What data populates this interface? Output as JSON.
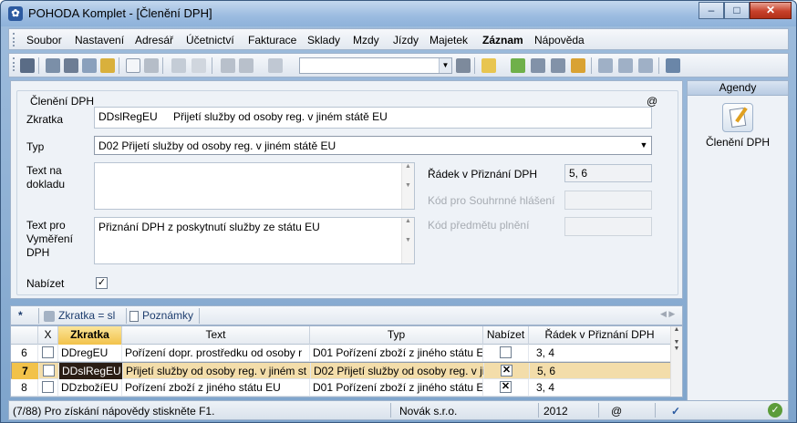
{
  "window": {
    "title": "POHODA Komplet - [Členění DPH]",
    "min": "–",
    "max": "□",
    "close": "✕"
  },
  "menu": [
    "Soubor",
    "Nastavení",
    "Adresář",
    "Účetnictví",
    "Fakturace",
    "Sklady",
    "Mzdy",
    "Jízdy",
    "Majetek",
    "Záznam",
    "Nápověda"
  ],
  "form": {
    "group_title": "Členění DPH",
    "at_sign": "@",
    "zkratka_label": "Zkratka",
    "zkratka_value": "DDslRegEU",
    "zkratka_text": "Přijetí služby od osoby reg. v jiném státě EU",
    "typ_label": "Typ",
    "typ_value": "D02 Přijetí služby od osoby reg. v jiném státě EU",
    "text_dokladu_label": "Text na dokladu",
    "text_dokladu_value": "",
    "text_vymereni_label": "Text pro Vyměření DPH",
    "text_vymereni_value": "Přiznání DPH z poskytnutí služby ze státu EU",
    "nabizet_label": "Nabízet",
    "nabizet_checked": "✓",
    "radek_label": "Řádek v Přiznání DPH",
    "radek_value": "5, 6",
    "kod_souhrnne_label": "Kód pro Souhrnné hlášení",
    "kod_souhrnne_value": "",
    "kod_predmetu_label": "Kód předmětu plnění",
    "kod_predmetu_value": ""
  },
  "agenda": {
    "header": "Agendy",
    "item": "Členění DPH"
  },
  "tabs": {
    "star": "*",
    "filter": "Zkratka = sl",
    "notes": "Poznámky"
  },
  "grid": {
    "columns": [
      "",
      "X",
      "Zkratka",
      "Text",
      "Typ",
      "Nabízet",
      "Řádek v Přiznání DPH"
    ],
    "rows": [
      {
        "num": "6",
        "zkratka": "DDregEU",
        "text": "Pořízení dopr. prostředku od osoby r",
        "typ": "D01 Pořízení zboží z jiného státu EU",
        "nabizet": "",
        "radek": "3, 4",
        "selected": false
      },
      {
        "num": "7",
        "zkratka": "DDslRegEU",
        "text": "Přijetí služby od osoby reg. v jiném st",
        "typ": "D02 Přijetí služby od osoby reg. v ji",
        "nabizet": "✕",
        "radek": "5, 6",
        "selected": true
      },
      {
        "num": "8",
        "zkratka": "DDzbožíEU",
        "text": "Pořízení zboží z jiného státu EU",
        "typ": "D01 Pořízení zboží z jiného státu EU",
        "nabizet": "✕",
        "radek": "3, 4",
        "selected": false
      }
    ]
  },
  "status": {
    "hint": "(7/88) Pro získání nápovědy stiskněte F1.",
    "company": "Novák  s.r.o.",
    "year": "2012",
    "at": "@"
  }
}
